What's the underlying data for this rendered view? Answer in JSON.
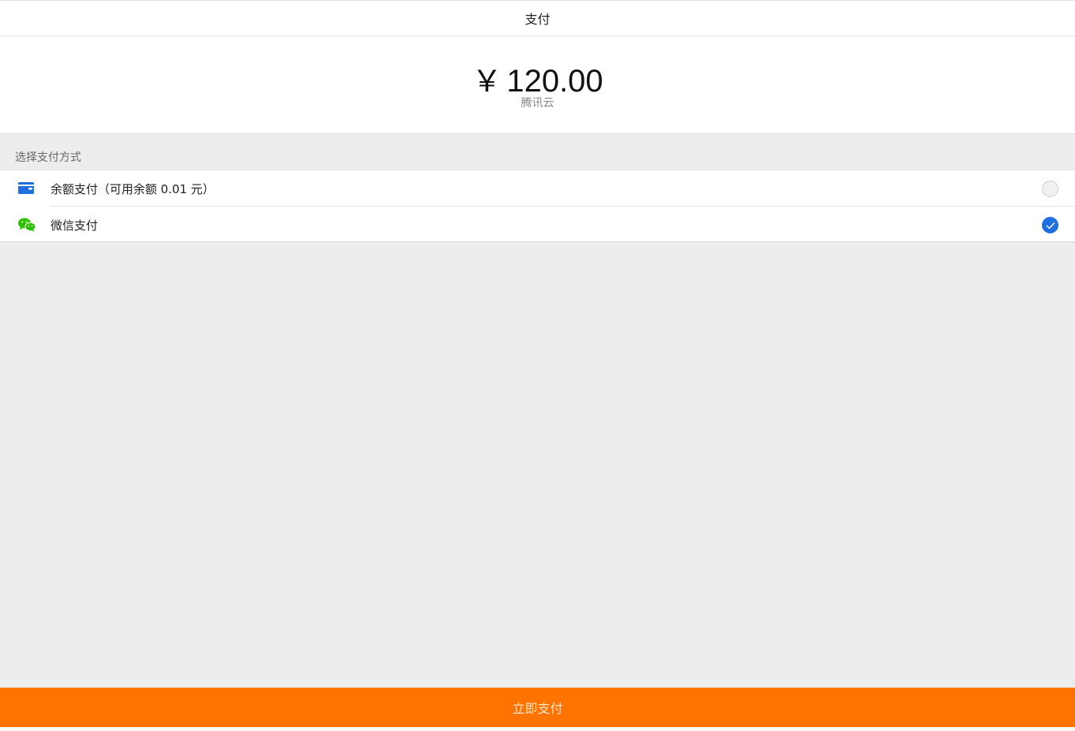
{
  "nav": {
    "title": "支付"
  },
  "payment": {
    "currency_symbol": "￥",
    "amount": "120.00",
    "merchant": "腾讯云"
  },
  "methods": {
    "section_label": "选择支付方式",
    "items": [
      {
        "label": "余额支付（可用余额 0.01 元）",
        "icon": "wallet-icon",
        "selected": false
      },
      {
        "label": "微信支付",
        "icon": "wechat-icon",
        "selected": true
      }
    ]
  },
  "action": {
    "pay_label": "立即支付"
  },
  "colors": {
    "accent": "#1e6fe0",
    "pay_button": "#ff7300",
    "wechat_green": "#2dc100"
  }
}
